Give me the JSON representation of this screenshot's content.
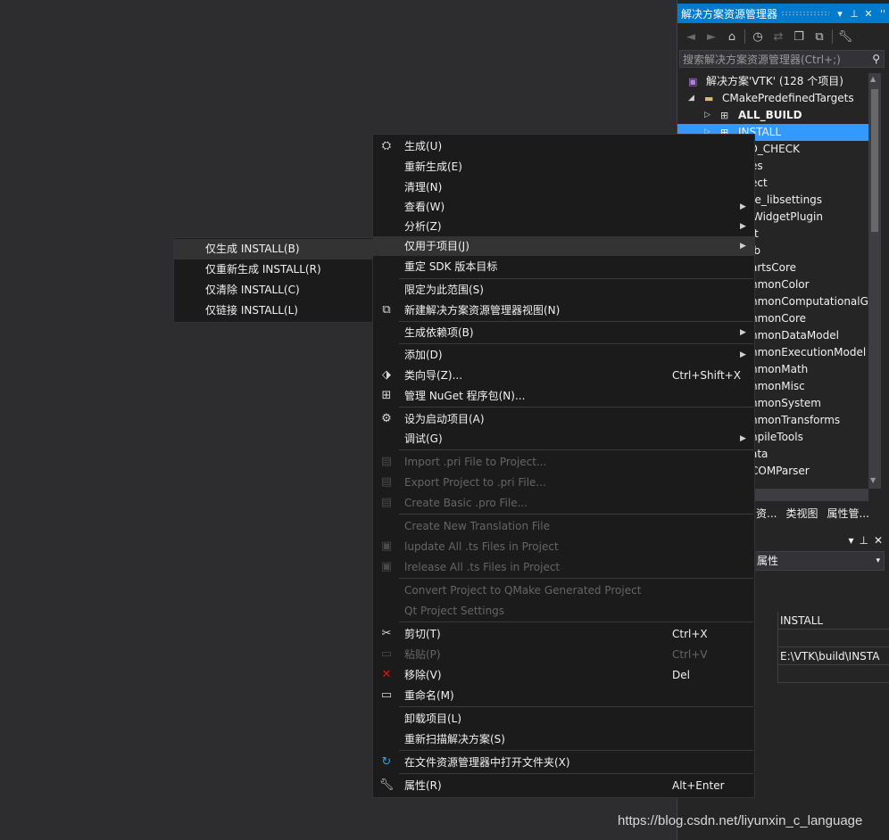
{
  "solution_explorer": {
    "title": "解决方案资源管理器",
    "title_buttons": {
      "dropdown": "▾",
      "pin": "⊥",
      "close": "✕",
      "more": "''"
    },
    "toolbar_icons": [
      "back-icon",
      "forward-icon",
      "home-icon",
      "history-icon",
      "sync-icon",
      "collapse-icon",
      "copy-icon",
      "wrench-icon"
    ],
    "search_placeholder": "搜索解决方案资源管理器(Ctrl+;)",
    "tree": [
      {
        "label": "解决方案'VTK' (128 个项目)",
        "bold": false
      },
      {
        "label": "CMakePredefinedTargets",
        "bold": false
      },
      {
        "label": "ALL_BUILD",
        "bold": true
      },
      {
        "label": "INSTALL",
        "bold": false,
        "selected": true
      },
      {
        "label": "RO_CHECK",
        "bold": false
      },
      {
        "label": "es",
        "bold": false
      },
      {
        "label": "ect",
        "bold": false
      },
      {
        "label": "ke_libsettings",
        "bold": false
      },
      {
        "label": "WidgetPlugin",
        "bold": false
      },
      {
        "label": "t",
        "bold": false
      },
      {
        "label": "ib",
        "bold": false
      },
      {
        "label": "artsCore",
        "bold": false
      },
      {
        "label": "nmonColor",
        "bold": false
      },
      {
        "label": "nmonComputationalG",
        "bold": false
      },
      {
        "label": "nmonCore",
        "bold": false
      },
      {
        "label": "nmonDataModel",
        "bold": false
      },
      {
        "label": "nmonExecutionModel",
        "bold": false
      },
      {
        "label": "nmonMath",
        "bold": false
      },
      {
        "label": "nmonMisc",
        "bold": false
      },
      {
        "label": "nmonSystem",
        "bold": false
      },
      {
        "label": "nmonTransforms",
        "bold": false
      },
      {
        "label": "npileTools",
        "bold": false
      },
      {
        "label": "ata",
        "bold": false
      },
      {
        "label": "COMParser",
        "bold": false
      }
    ],
    "tabs": [
      "资...",
      "类视图",
      "属性管..."
    ],
    "properties": {
      "combo_value": "属性",
      "name_value": "INSTALL",
      "path_value": "E:\\VTK\\build\\INSTA"
    }
  },
  "context_menu": {
    "items": [
      {
        "label": "生成(U)",
        "icon": "build-icon"
      },
      {
        "label": "重新生成(E)"
      },
      {
        "label": "清理(N)"
      },
      {
        "label": "查看(W)",
        "submenu": true
      },
      {
        "label": "分析(Z)",
        "submenu": true
      },
      {
        "label": "仅用于项目(J)",
        "submenu": true,
        "highlighted": true
      },
      {
        "label": "重定 SDK 版本目标"
      },
      {
        "label": "限定为此范围(S)"
      },
      {
        "label": "新建解决方案资源管理器视图(N)",
        "icon": "new-view-icon"
      },
      {
        "label": "生成依赖项(B)",
        "submenu": true
      },
      {
        "label": "添加(D)",
        "submenu": true
      },
      {
        "label": "类向导(Z)...",
        "icon": "class-wizard-icon",
        "shortcut": "Ctrl+Shift+X"
      },
      {
        "label": "管理 NuGet 程序包(N)...",
        "icon": "nuget-icon"
      },
      {
        "label": "设为启动项目(A)",
        "icon": "gear-icon"
      },
      {
        "label": "调试(G)",
        "submenu": true
      },
      {
        "label": "Import .pri File to Project...",
        "icon": "import-pri-icon",
        "disabled": true
      },
      {
        "label": "Export Project to .pri File...",
        "icon": "export-pri-icon",
        "disabled": true
      },
      {
        "label": "Create Basic .pro File...",
        "icon": "create-pro-icon",
        "disabled": true
      },
      {
        "label": "Create New Translation File",
        "disabled": true
      },
      {
        "label": "lupdate All .ts Files in Project",
        "icon": "lupdate-icon",
        "disabled": true
      },
      {
        "label": "lrelease All .ts Files in Project",
        "icon": "lrelease-icon",
        "disabled": true
      },
      {
        "label": "Convert Project to QMake Generated Project",
        "disabled": true
      },
      {
        "label": "Qt Project Settings",
        "disabled": true
      },
      {
        "label": "剪切(T)",
        "icon": "scissors-icon",
        "shortcut": "Ctrl+X"
      },
      {
        "label": "粘贴(P)",
        "icon": "paste-icon",
        "shortcut": "Ctrl+V",
        "disabled": true
      },
      {
        "label": "移除(V)",
        "icon": "remove-icon",
        "shortcut": "Del"
      },
      {
        "label": "重命名(M)",
        "icon": "rename-icon"
      },
      {
        "label": "卸载项目(L)"
      },
      {
        "label": "重新扫描解决方案(S)"
      },
      {
        "label": "在文件资源管理器中打开文件夹(X)",
        "icon": "refresh-arrow-icon"
      },
      {
        "label": "属性(R)",
        "icon": "wrench-icon",
        "shortcut": "Alt+Enter"
      }
    ],
    "submenu_items": [
      {
        "label": "仅生成 INSTALL(B)",
        "highlighted": true
      },
      {
        "label": "仅重新生成 INSTALL(R)"
      },
      {
        "label": "仅清除 INSTALL(C)"
      },
      {
        "label": "仅链接 INSTALL(L)"
      }
    ]
  },
  "watermark": "https://blog.csdn.net/liyunxin_c_language",
  "colors": {
    "accent": "#007acc",
    "selection": "#3399ff",
    "background": "#2d2d30",
    "menu": "#1b1b1c"
  }
}
